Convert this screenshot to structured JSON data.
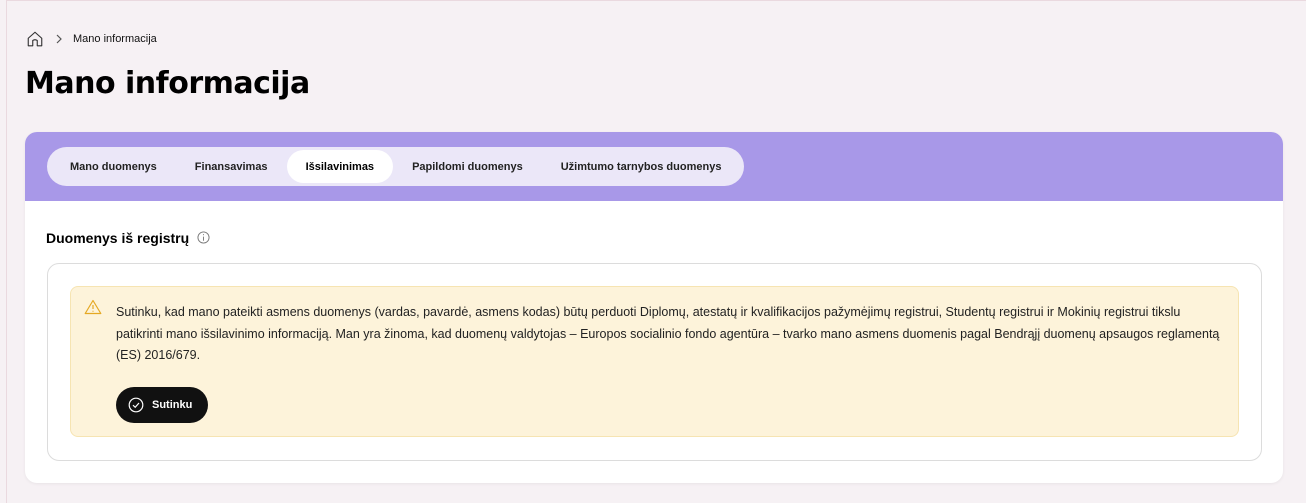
{
  "breadcrumb": {
    "home_icon": "home-icon",
    "separator_icon": "chevron-right-icon",
    "current": "Mano informacija"
  },
  "page": {
    "title": "Mano informacija"
  },
  "tabs": [
    {
      "label": "Mano duomenys",
      "active": false
    },
    {
      "label": "Finansavimas",
      "active": false
    },
    {
      "label": "Išsilavinimas",
      "active": true
    },
    {
      "label": "Papildomi duomenys",
      "active": false
    },
    {
      "label": "Užimtumo tarnybos duomenys",
      "active": false
    }
  ],
  "section": {
    "title": "Duomenys iš registrų",
    "info_icon": "info-icon"
  },
  "consent": {
    "icon": "warning-icon",
    "text": "Sutinku, kad mano pateikti asmens duomenys (vardas, pavardė, asmens kodas) būtų perduoti Diplomų, atestatų ir kvalifikacijos pažymėjimų registrui, Studentų registrui ir Mokinių registrui tikslu patikrinti mano išsilavinimo informaciją. Man yra žinoma, kad duomenų valdytojas – Europos socialinio fondo agentūra – tvarko mano asmens duomenis pagal Bendrąjį duomenų apsaugos reglamentą (ES) 2016/679.",
    "button_label": "Sutinku",
    "button_icon": "check-circle-icon"
  },
  "colors": {
    "page_bg": "#f6f1f4",
    "tabbar_bg": "#a898e8",
    "tabs_pill_bg": "#ebe7f8",
    "alert_bg": "#fdf3da",
    "alert_border": "#f6e4b2",
    "warning": "#e5a823",
    "button_bg": "#111111"
  }
}
